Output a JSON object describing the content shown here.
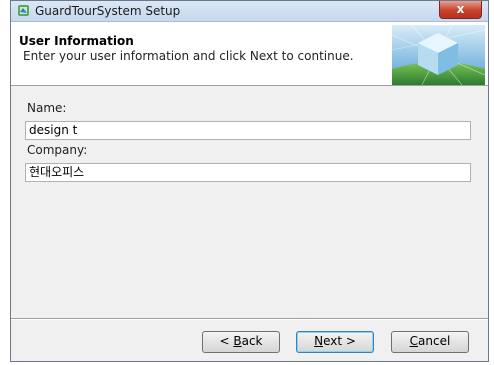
{
  "window": {
    "title": "GuardTourSystem Setup",
    "close_glyph": "x"
  },
  "header": {
    "title": "User Information",
    "subtitle": "Enter your user information and click Next to continue."
  },
  "form": {
    "name_label": "Name:",
    "name_value": "design t",
    "company_label": "Company:",
    "company_value": "현대오피스"
  },
  "buttons": {
    "back": {
      "prefix": "< ",
      "mnemonic": "B",
      "rest": "ack"
    },
    "next": {
      "mnemonic": "N",
      "rest": "ext >"
    },
    "cancel": {
      "mnemonic": "C",
      "rest": "ancel"
    }
  },
  "icons": {
    "title": "installer-icon",
    "banner": "cube-globe-banner"
  },
  "colors": {
    "close_button": "#c7432b",
    "default_button_border": "#3c7fb1"
  }
}
